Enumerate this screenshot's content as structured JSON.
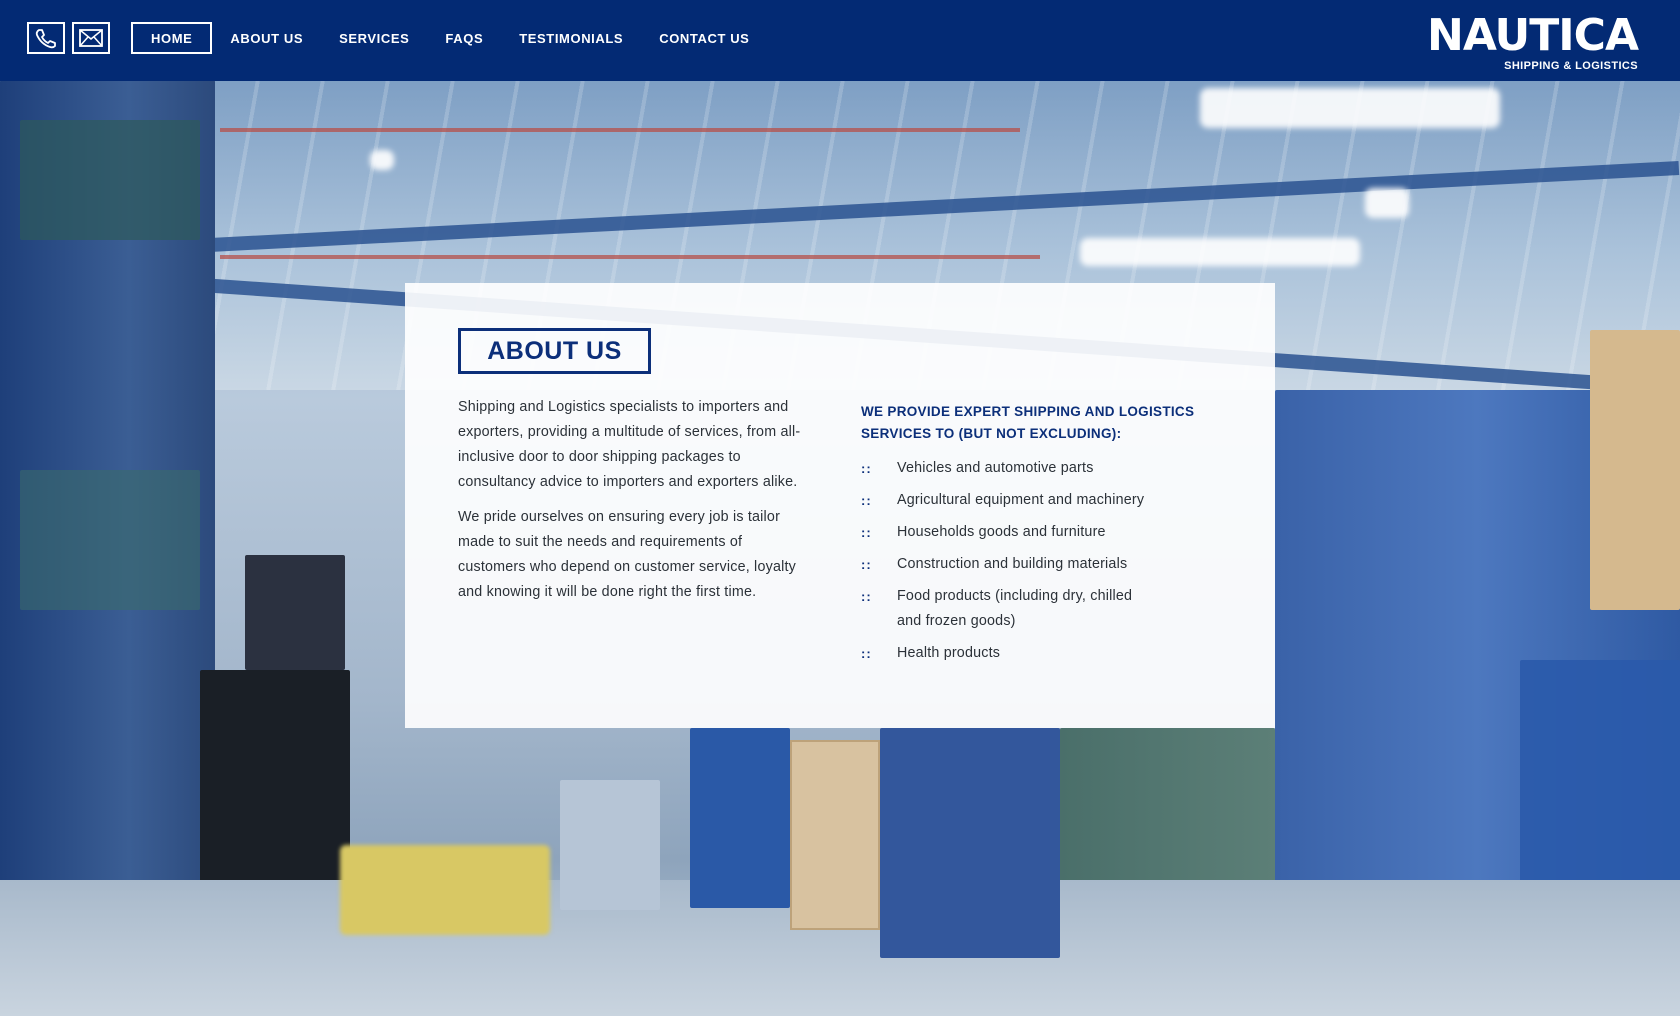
{
  "header": {
    "icons": [
      {
        "name": "phone-icon"
      },
      {
        "name": "mail-icon"
      }
    ],
    "nav": [
      {
        "label": "HOME",
        "active": true
      },
      {
        "label": "ABOUT US",
        "active": false
      },
      {
        "label": "SERVICES",
        "active": false
      },
      {
        "label": "FAQS",
        "active": false
      },
      {
        "label": "TESTIMONIALS",
        "active": false
      },
      {
        "label": "CONTACT US",
        "active": false
      }
    ],
    "logo": {
      "name": "NAUTICA",
      "tagline": "SHIPPING & LOGISTICS"
    }
  },
  "about": {
    "title": "ABOUT US",
    "paragraphs": [
      "Shipping and Logistics specialists to importers and exporters, providing a multitude of services, from all-inclusive door to door shipping packages to consultancy advice to importers and exporters alike.",
      "We pride ourselves on ensuring every job is tailor made to suit the needs and requirements of customers who depend on customer service, loyalty and knowing it will be done right the first time."
    ],
    "lead": "WE PROVIDE EXPERT SHIPPING AND LOGISTICS SERVICES TO (BUT NOT EXCLUDING):",
    "bullet_glyph": "::",
    "services": [
      "Vehicles and automotive parts",
      "Agricultural equipment and machinery",
      "Households goods and furniture",
      "Construction and building materials",
      "Food products (including dry, chilled and frozen goods)",
      "Health products"
    ]
  },
  "colors": {
    "header_bg": "#032a74",
    "accent": "#0c2f7a",
    "card_bg": "#ffffff"
  }
}
